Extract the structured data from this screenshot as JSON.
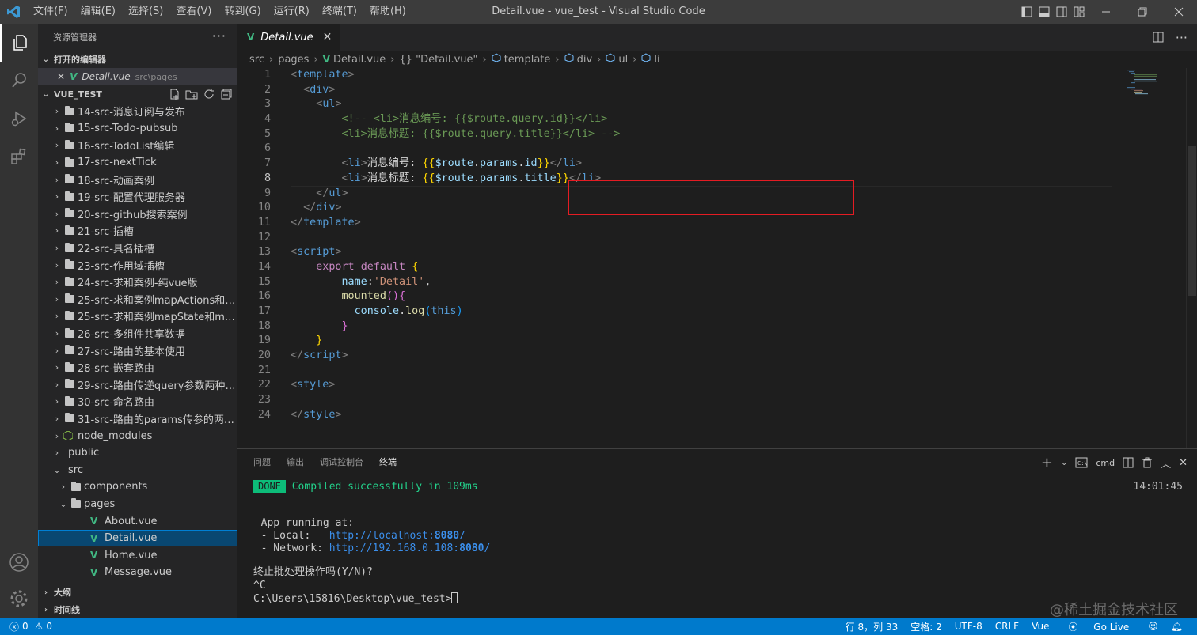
{
  "titlebar": {
    "menu": [
      "文件(F)",
      "编辑(E)",
      "选择(S)",
      "查看(V)",
      "转到(G)",
      "运行(R)",
      "终端(T)",
      "帮助(H)"
    ],
    "window_title": "Detail.vue - vue_test - Visual Studio Code"
  },
  "sidebar": {
    "header": "资源管理器",
    "open_editors_label": "打开的编辑器",
    "open_editor": {
      "name": "Detail.vue",
      "path": "src\\pages"
    },
    "workspace_label": "VUE_TEST",
    "tree": [
      {
        "label": "14-src-消息订阅与发布",
        "type": "folder",
        "depth": 0,
        "expanded": false
      },
      {
        "label": "15-src-Todo-pubsub",
        "type": "folder",
        "depth": 0,
        "expanded": false
      },
      {
        "label": "16-src-TodoList编辑",
        "type": "folder",
        "depth": 0,
        "expanded": false
      },
      {
        "label": "17-src-nextTick",
        "type": "folder",
        "depth": 0,
        "expanded": false
      },
      {
        "label": "18-src-动画案例",
        "type": "folder",
        "depth": 0,
        "expanded": false
      },
      {
        "label": "19-src-配置代理服务器",
        "type": "folder",
        "depth": 0,
        "expanded": false
      },
      {
        "label": "20-src-github搜索案例",
        "type": "folder",
        "depth": 0,
        "expanded": false
      },
      {
        "label": "21-src-插槽",
        "type": "folder",
        "depth": 0,
        "expanded": false
      },
      {
        "label": "22-src-具名插槽",
        "type": "folder",
        "depth": 0,
        "expanded": false
      },
      {
        "label": "23-src-作用域插槽",
        "type": "folder",
        "depth": 0,
        "expanded": false
      },
      {
        "label": "24-src-求和案例-纯vue版",
        "type": "folder",
        "depth": 0,
        "expanded": false
      },
      {
        "label": "25-src-求和案例mapActions和ma...",
        "type": "folder",
        "depth": 0,
        "expanded": false
      },
      {
        "label": "25-src-求和案例mapState和map...",
        "type": "folder",
        "depth": 0,
        "expanded": false
      },
      {
        "label": "26-src-多组件共享数据",
        "type": "folder",
        "depth": 0,
        "expanded": false
      },
      {
        "label": "27-src-路由的基本使用",
        "type": "folder",
        "depth": 0,
        "expanded": false
      },
      {
        "label": "28-src-嵌套路由",
        "type": "folder",
        "depth": 0,
        "expanded": false
      },
      {
        "label": "29-src-路由传递query参数两种方...",
        "type": "folder",
        "depth": 0,
        "expanded": false
      },
      {
        "label": "30-src-命名路由",
        "type": "folder",
        "depth": 0,
        "expanded": false
      },
      {
        "label": "31-src-路由的params传参的两种...",
        "type": "folder",
        "depth": 0,
        "expanded": false
      },
      {
        "label": "node_modules",
        "type": "modules",
        "depth": 0,
        "expanded": false
      },
      {
        "label": "public",
        "type": "plain",
        "depth": 0,
        "expanded": false
      },
      {
        "label": "src",
        "type": "plain",
        "depth": 0,
        "expanded": true
      },
      {
        "label": "components",
        "type": "folder",
        "depth": 1,
        "expanded": false
      },
      {
        "label": "pages",
        "type": "folder",
        "depth": 1,
        "expanded": true
      },
      {
        "label": "About.vue",
        "type": "vue",
        "depth": 2
      },
      {
        "label": "Detail.vue",
        "type": "vue",
        "depth": 2,
        "selected": true
      },
      {
        "label": "Home.vue",
        "type": "vue",
        "depth": 2
      },
      {
        "label": "Message.vue",
        "type": "vue",
        "depth": 2
      }
    ],
    "outline_label": "大纲",
    "timeline_label": "时间线"
  },
  "editor": {
    "tab": "Detail.vue",
    "breadcrumbs": [
      "src",
      "pages",
      "Detail.vue",
      "{} \"Detail.vue\"",
      "template",
      "div",
      "ul",
      "li"
    ],
    "line_numbers": [
      "1",
      "2",
      "3",
      "4",
      "5",
      "6",
      "7",
      "8",
      "9",
      "10",
      "11",
      "12",
      "13",
      "14",
      "15",
      "16",
      "17",
      "18",
      "19",
      "20",
      "21",
      "22",
      "23",
      "24"
    ],
    "current_line": 8,
    "code": [
      [
        [
          "t-br",
          "<"
        ],
        [
          "t-tag",
          "template"
        ],
        [
          "t-br",
          ">"
        ]
      ],
      [
        [
          "t-txt",
          "  "
        ],
        [
          "t-br",
          "<"
        ],
        [
          "t-tag",
          "div"
        ],
        [
          "t-br",
          ">"
        ]
      ],
      [
        [
          "t-txt",
          "    "
        ],
        [
          "t-br",
          "<"
        ],
        [
          "t-tag",
          "ul"
        ],
        [
          "t-br",
          ">"
        ]
      ],
      [
        [
          "t-txt",
          "        "
        ],
        [
          "t-cm",
          "<!-- <li>消息编号: {{$route.query.id}}</li>"
        ]
      ],
      [
        [
          "t-txt",
          "        "
        ],
        [
          "t-cm",
          "<li>消息标题: {{$route.query.title}}</li> -->"
        ]
      ],
      [],
      [
        [
          "t-txt",
          "        "
        ],
        [
          "t-br",
          "<"
        ],
        [
          "t-tag",
          "li"
        ],
        [
          "t-br",
          ">"
        ],
        [
          "t-txt",
          "消息编号: "
        ],
        [
          "t-br1",
          "{{"
        ],
        [
          "t-var",
          "$route"
        ],
        [
          "t-txt",
          "."
        ],
        [
          "t-var",
          "params"
        ],
        [
          "t-txt",
          "."
        ],
        [
          "t-var",
          "id"
        ],
        [
          "t-br1",
          "}}"
        ],
        [
          "t-br",
          "</"
        ],
        [
          "t-tag",
          "li"
        ],
        [
          "t-br",
          ">"
        ]
      ],
      [
        [
          "t-txt",
          "        "
        ],
        [
          "t-br",
          "<"
        ],
        [
          "t-tag",
          "li"
        ],
        [
          "t-br",
          ">"
        ],
        [
          "t-txt",
          "消息标题: "
        ],
        [
          "t-br1",
          "{{"
        ],
        [
          "t-var",
          "$route"
        ],
        [
          "t-txt",
          "."
        ],
        [
          "t-var",
          "params"
        ],
        [
          "t-txt",
          "."
        ],
        [
          "t-var",
          "title"
        ],
        [
          "t-br1",
          "}}"
        ],
        [
          "t-br",
          "</"
        ],
        [
          "t-tag",
          "li"
        ],
        [
          "t-br",
          ">"
        ]
      ],
      [
        [
          "t-txt",
          "    "
        ],
        [
          "t-br",
          "</"
        ],
        [
          "t-tag",
          "ul"
        ],
        [
          "t-br",
          ">"
        ]
      ],
      [
        [
          "t-txt",
          "  "
        ],
        [
          "t-br",
          "</"
        ],
        [
          "t-tag",
          "div"
        ],
        [
          "t-br",
          ">"
        ]
      ],
      [
        [
          "t-br",
          "</"
        ],
        [
          "t-tag",
          "template"
        ],
        [
          "t-br",
          ">"
        ]
      ],
      [],
      [
        [
          "t-br",
          "<"
        ],
        [
          "t-tag",
          "script"
        ],
        [
          "t-br",
          ">"
        ]
      ],
      [
        [
          "t-txt",
          "    "
        ],
        [
          "t-kw",
          "export"
        ],
        [
          "t-txt",
          " "
        ],
        [
          "t-kw",
          "default"
        ],
        [
          "t-txt",
          " "
        ],
        [
          "t-br1",
          "{"
        ]
      ],
      [
        [
          "t-txt",
          "        "
        ],
        [
          "t-var",
          "name"
        ],
        [
          "t-txt",
          ":"
        ],
        [
          "t-str",
          "'Detail'"
        ],
        [
          "t-txt",
          ","
        ]
      ],
      [
        [
          "t-txt",
          "        "
        ],
        [
          "t-fn",
          "mounted"
        ],
        [
          "t-br2",
          "()"
        ],
        [
          "t-br2",
          "{"
        ]
      ],
      [
        [
          "t-txt",
          "          "
        ],
        [
          "t-var",
          "console"
        ],
        [
          "t-txt",
          "."
        ],
        [
          "t-fn",
          "log"
        ],
        [
          "t-br3",
          "("
        ],
        [
          "t-this",
          "this"
        ],
        [
          "t-br3",
          ")"
        ]
      ],
      [
        [
          "t-txt",
          "        "
        ],
        [
          "t-br2",
          "}"
        ]
      ],
      [
        [
          "t-txt",
          "    "
        ],
        [
          "t-br1",
          "}"
        ]
      ],
      [
        [
          "t-br",
          "</"
        ],
        [
          "t-tag",
          "script"
        ],
        [
          "t-br",
          ">"
        ]
      ],
      [],
      [
        [
          "t-br",
          "<"
        ],
        [
          "t-tag",
          "style"
        ],
        [
          "t-br",
          ">"
        ]
      ],
      [],
      [
        [
          "t-br",
          "</"
        ],
        [
          "t-tag",
          "style"
        ],
        [
          "t-br",
          ">"
        ]
      ]
    ]
  },
  "panel": {
    "tabs": [
      "问题",
      "输出",
      "调试控制台",
      "终端"
    ],
    "active_tab": "终端",
    "shell": "cmd",
    "terminal": {
      "done_badge": "DONE",
      "compiled": "Compiled successfully in 109ms",
      "time": "14:01:45",
      "app_running": "  App running at:",
      "local_label": "  - Local:   ",
      "local_url_prefix": "http://localhost:",
      "local_port": "8080",
      "local_slash": "/",
      "network_label": "  - Network: ",
      "network_url_prefix": "http://192.168.0.108:",
      "network_port": "8080",
      "network_slash": "/",
      "terminate_prompt": "终止批处理操作吗(Y/N)?",
      "ctrl_c": "^C",
      "prompt": "C:\\Users\\15816\\Desktop\\vue_test>"
    }
  },
  "statusbar": {
    "errors": "0",
    "warnings": "0",
    "position": "行 8，列 33",
    "spaces": "空格: 2",
    "encoding": "UTF-8",
    "eol": "CRLF",
    "language": "Vue",
    "golive": "Go Live"
  },
  "watermark": "@稀土掘金技术社区",
  "colors": {
    "accent": "#007acc",
    "highlight_box": "#e51c23",
    "vue_green": "#41b883"
  }
}
